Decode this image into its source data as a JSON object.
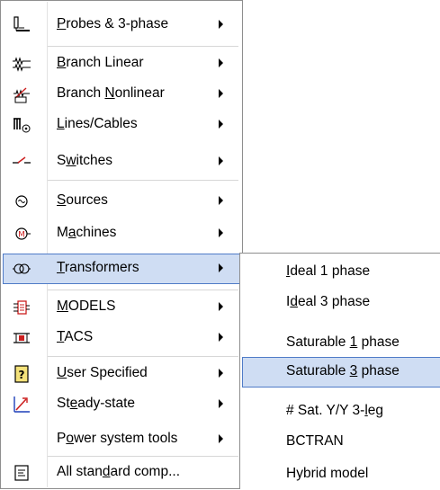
{
  "main_menu": {
    "items": [
      {
        "pre": "",
        "key": "P",
        "post": "robes & 3-phase",
        "icon": "probe-icon",
        "submenu": true
      },
      {
        "pre": "",
        "key": "B",
        "post": "ranch Linear",
        "icon": "branch-linear-icon",
        "submenu": true
      },
      {
        "pre": "Branch ",
        "key": "N",
        "post": "onlinear",
        "icon": "branch-nonlinear-icon",
        "submenu": true
      },
      {
        "pre": "",
        "key": "L",
        "post": "ines/Cables",
        "icon": "lines-cables-icon",
        "submenu": true
      },
      {
        "pre": "S",
        "key": "w",
        "post": "itches",
        "icon": "switch-icon",
        "submenu": true
      },
      {
        "pre": "",
        "key": "S",
        "post": "ources",
        "icon": "source-icon",
        "submenu": true
      },
      {
        "pre": "M",
        "key": "a",
        "post": "chines",
        "icon": "machine-icon",
        "submenu": true
      },
      {
        "pre": "",
        "key": "T",
        "post": "ransformers",
        "icon": "transformer-icon",
        "submenu": true
      },
      {
        "pre": "",
        "key": "M",
        "post": "ODELS",
        "icon": "models-icon",
        "submenu": true
      },
      {
        "pre": "",
        "key": "T",
        "post": "ACS",
        "icon": "tacs-icon",
        "submenu": true
      },
      {
        "pre": "",
        "key": "U",
        "post": "ser Specified",
        "icon": "user-specified-icon",
        "submenu": true
      },
      {
        "pre": "St",
        "key": "e",
        "post": "ady-state",
        "icon": "steady-state-icon",
        "submenu": true
      },
      {
        "pre": "P",
        "key": "o",
        "post": "wer system tools",
        "icon": "",
        "submenu": true
      },
      {
        "pre": "All stan",
        "key": "d",
        "post": "ard comp...",
        "icon": "standard-components-icon",
        "submenu": false
      }
    ],
    "highlighted": "Transformers"
  },
  "transformers_submenu": {
    "items": [
      {
        "pre": "",
        "key": "I",
        "post": "deal 1 phase"
      },
      {
        "pre": "I",
        "key": "d",
        "post": "eal 3 phase"
      },
      {
        "pre": "Saturable ",
        "key": "1",
        "post": " phase"
      },
      {
        "pre": "Saturable ",
        "key": "3",
        "post": " phase"
      },
      {
        "pre": "# Sat. Y/Y 3-",
        "key": "l",
        "post": "eg"
      },
      {
        "pre": "BCTRAN",
        "key": "",
        "post": ""
      },
      {
        "pre": "Hybrid model",
        "key": "",
        "post": ""
      }
    ],
    "highlighted": "Saturable 3 phase"
  },
  "colors": {
    "highlight_bg": "#cfddf3",
    "highlight_border": "#4f7bc7",
    "menu_border": "#8e8e8e",
    "icon_red": "#cc1f1f",
    "icon_blue": "#1d3fb8"
  }
}
